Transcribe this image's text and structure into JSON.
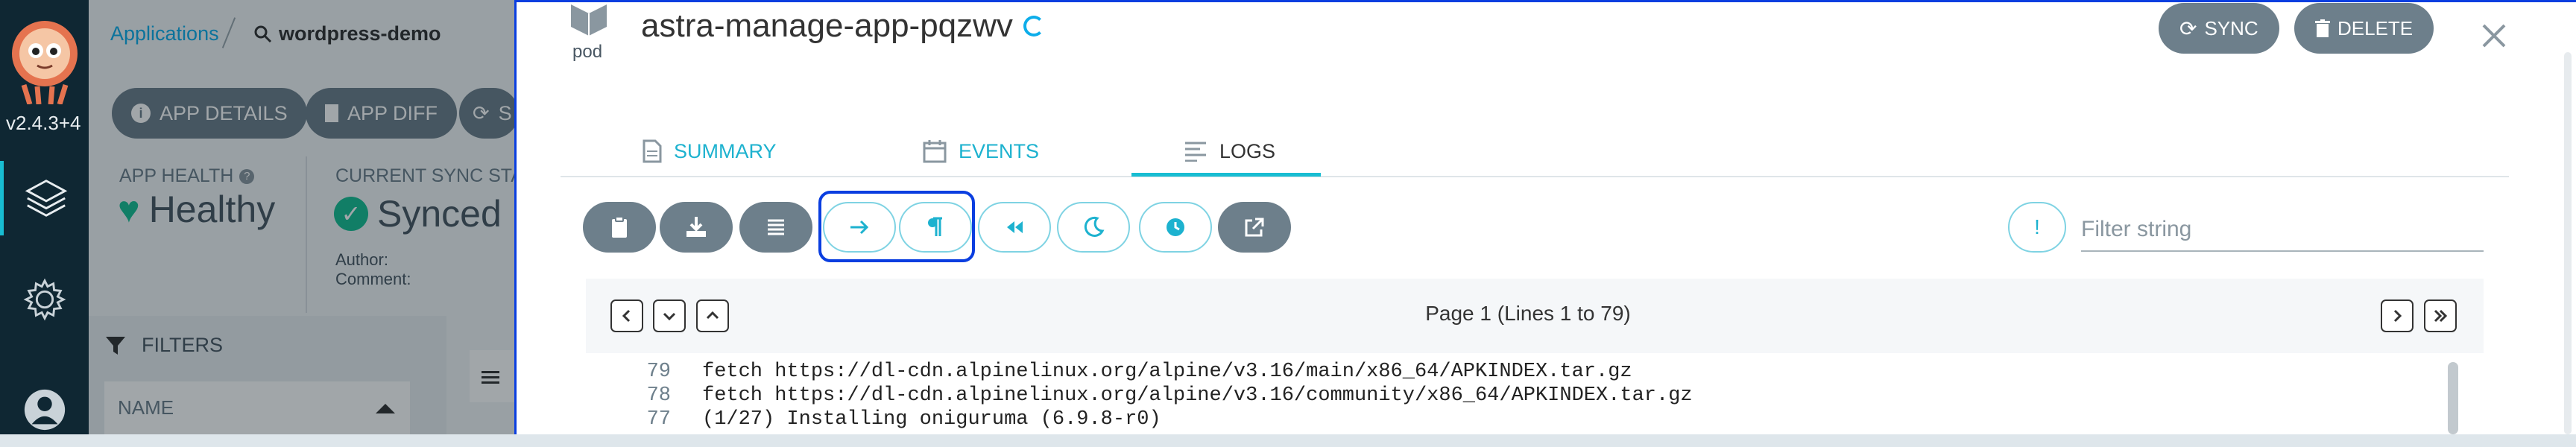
{
  "nav": {
    "version": "v2.4.3+4"
  },
  "background": {
    "breadcrumb_root": "Applications",
    "breadcrumb_app": "wordpress-demo",
    "buttons": {
      "app_details": "APP DETAILS",
      "app_diff": "APP DIFF",
      "sync_partial": "S"
    },
    "app_health_label": "APP HEALTH",
    "app_health_value": "Healthy",
    "sync_status_label": "CURRENT SYNC STA",
    "sync_status_value": "Synced",
    "author_label": "Author:",
    "comment_label": "Comment:",
    "filters_title": "FILTERS",
    "name_filter_label": "NAME"
  },
  "panel": {
    "resource_kind": "pod",
    "resource_name": "astra-manage-app-pqzwv",
    "sync_button": "SYNC",
    "delete_button": "DELETE",
    "tabs": [
      {
        "label": "SUMMARY",
        "icon": "file-icon"
      },
      {
        "label": "EVENTS",
        "icon": "calendar-icon"
      },
      {
        "label": "LOGS",
        "icon": "log-lines-icon"
      }
    ],
    "active_tab": "LOGS",
    "toolbar_icons": [
      "clipboard-icon",
      "download-icon",
      "align-icon",
      "arrow-right-icon",
      "pilcrow-icon",
      "rewind-icon",
      "moon-icon",
      "clock-icon",
      "external-link-icon"
    ],
    "filter_placeholder": "Filter string",
    "filter_mode_symbol": "!",
    "page_info": "Page 1 (Lines 1 to 79)",
    "log_lines": [
      {
        "num": "79",
        "text": "fetch https://dl-cdn.alpinelinux.org/alpine/v3.16/main/x86_64/APKINDEX.tar.gz"
      },
      {
        "num": "78",
        "text": "fetch https://dl-cdn.alpinelinux.org/alpine/v3.16/community/x86_64/APKINDEX.tar.gz"
      },
      {
        "num": "77",
        "text": "(1/27) Installing oniguruma (6.9.8-r0)"
      }
    ]
  },
  "colors": {
    "accent": "#18bdd2",
    "nav_bg": "#0f2733",
    "button_gray": "#6d7f8b",
    "focus_outline": "#0a3ee0",
    "health_green": "#18be94"
  }
}
